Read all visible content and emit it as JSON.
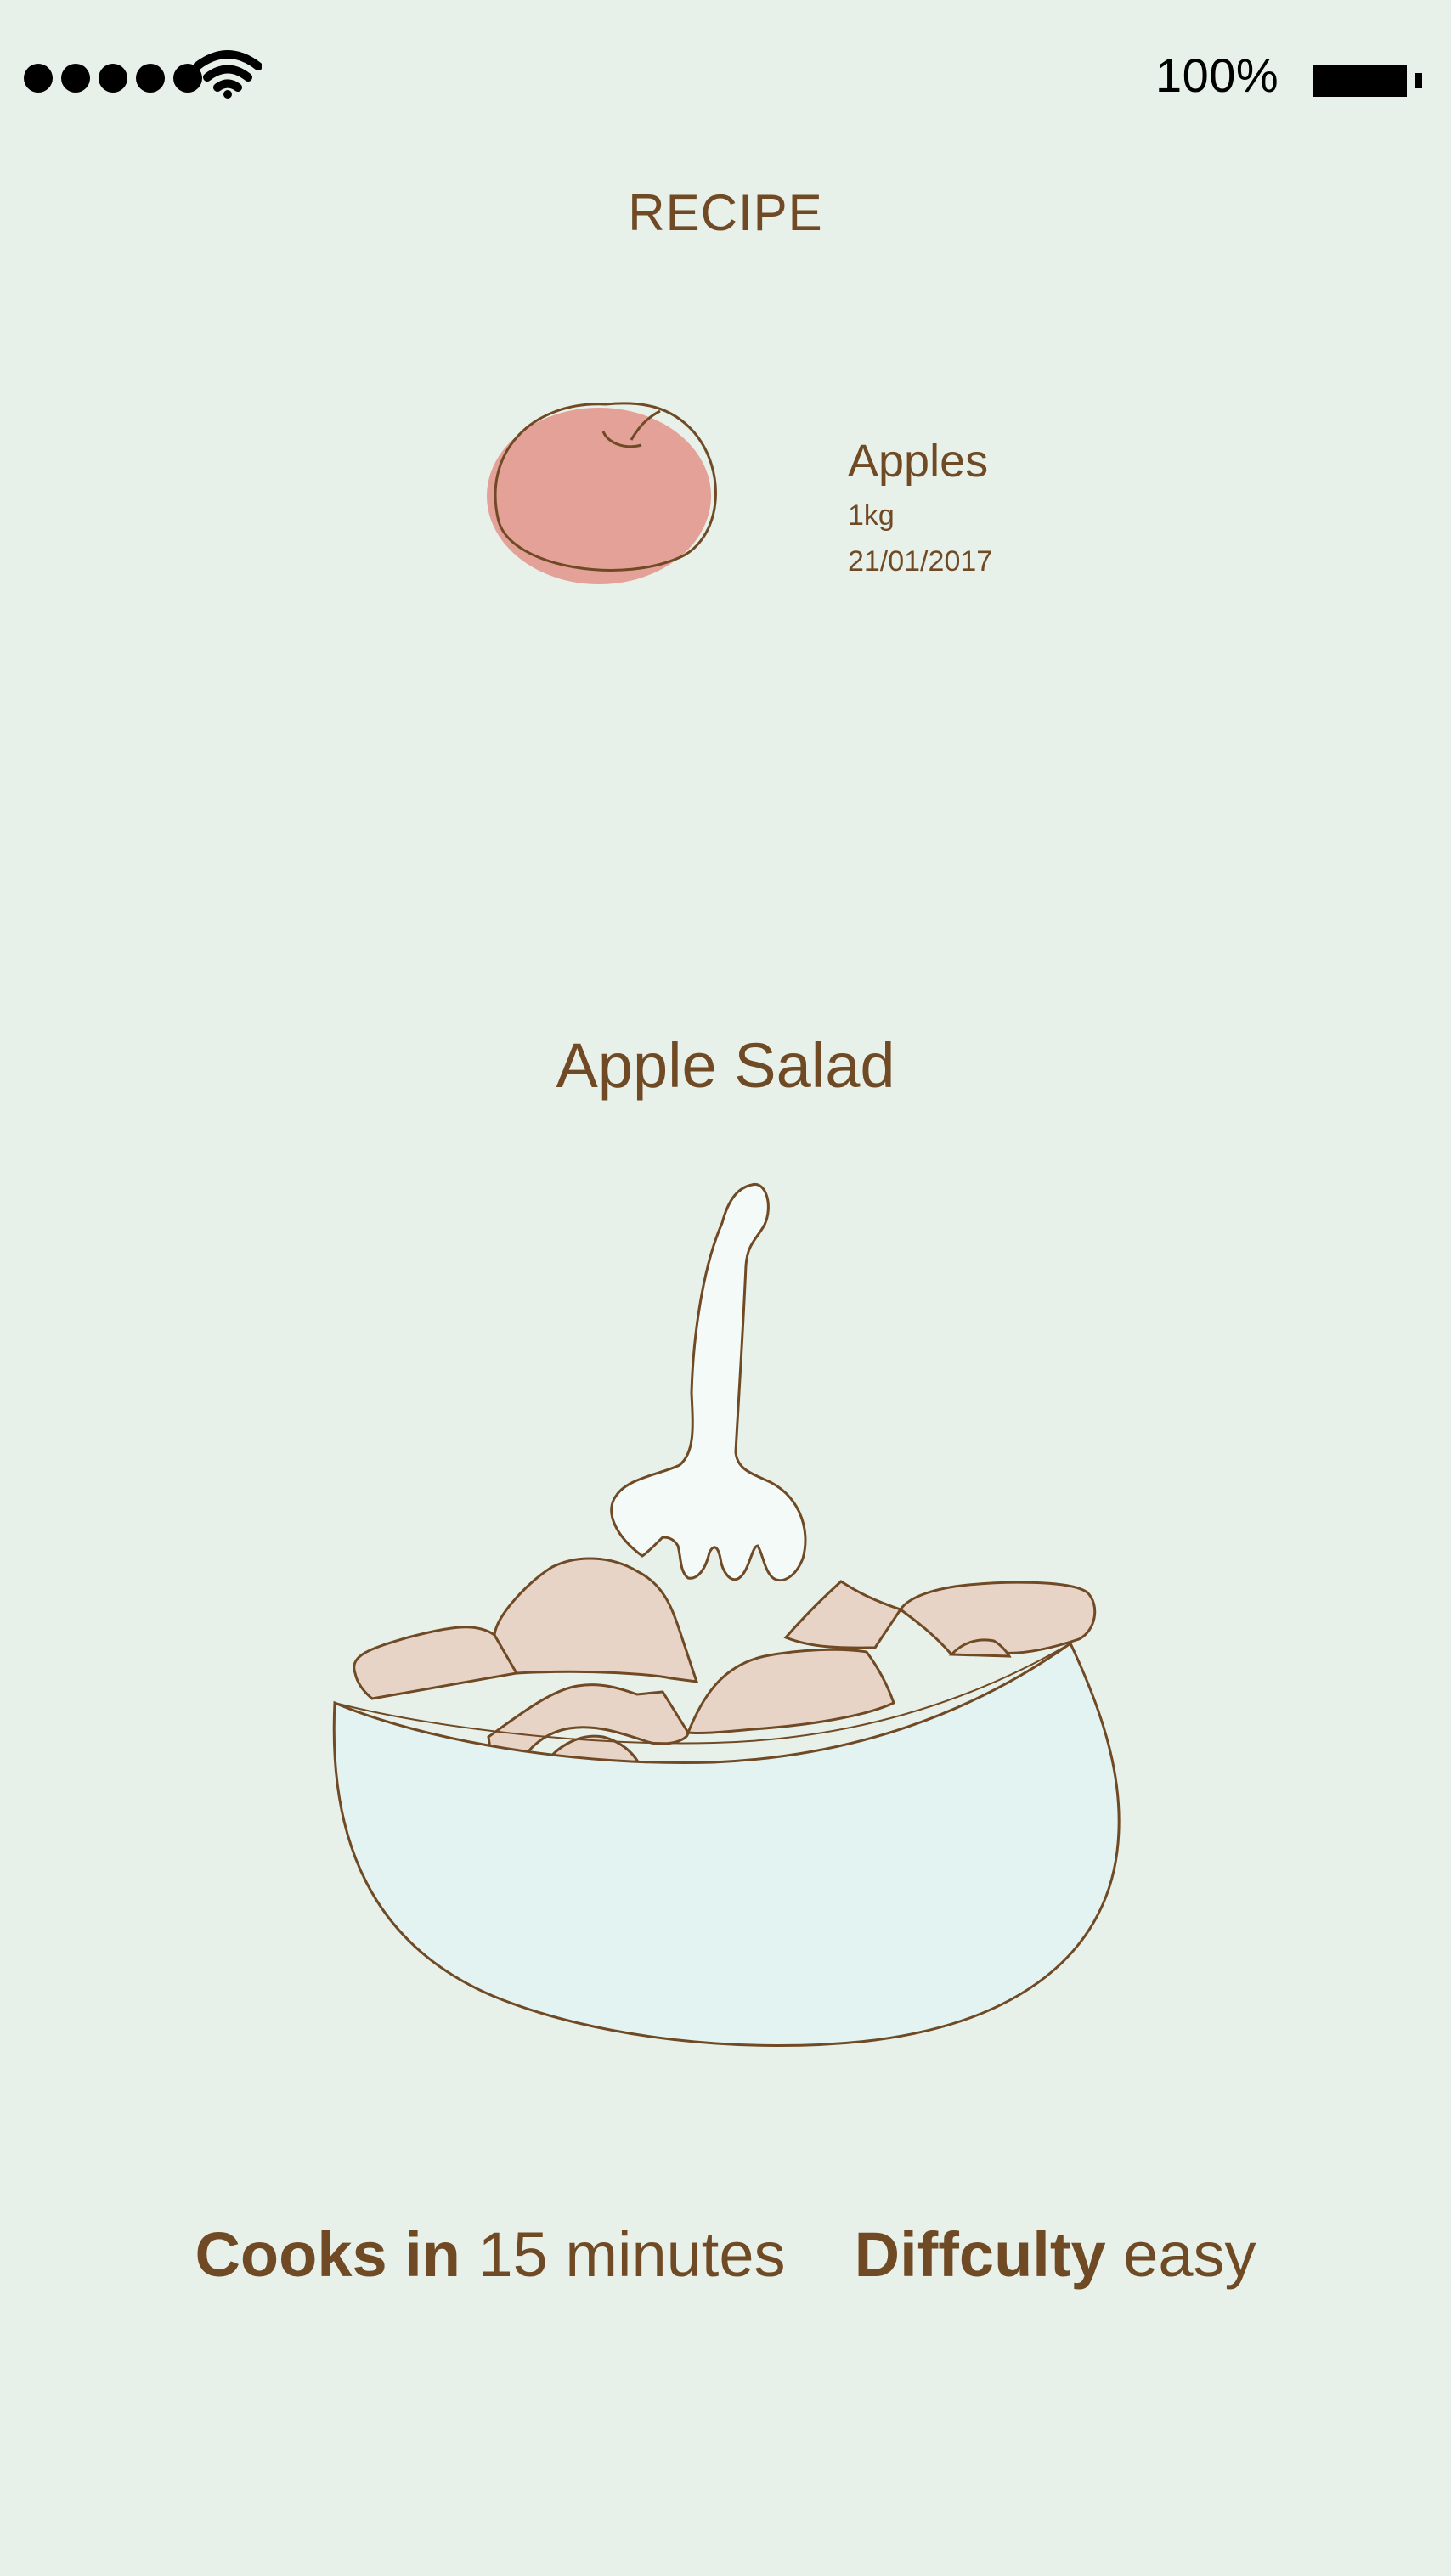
{
  "status_bar": {
    "signal_icon": "signal-dots-icon",
    "wifi_icon": "wifi-icon",
    "battery_percent": "100%",
    "battery_icon": "battery-full-icon"
  },
  "header": {
    "title": "RECIPE"
  },
  "ingredient": {
    "icon": "apple-icon",
    "name": "Apples",
    "quantity": "1kg",
    "date": "21/01/2017"
  },
  "dish": {
    "title": "Apple Salad",
    "illustration": "salad-bowl-illustration"
  },
  "footer": {
    "cook_label": "Cooks in",
    "cook_value": "15 minutes",
    "difficulty_label": "Diffculty",
    "difficulty_value": "easy"
  },
  "colors": {
    "background": "#e7f1e9",
    "text_brown": "#6f4a25",
    "apple_fill": "#e3a197",
    "apple_piece_fill": "#e8d4c7",
    "bowl_fill": "#e3f3f2"
  }
}
